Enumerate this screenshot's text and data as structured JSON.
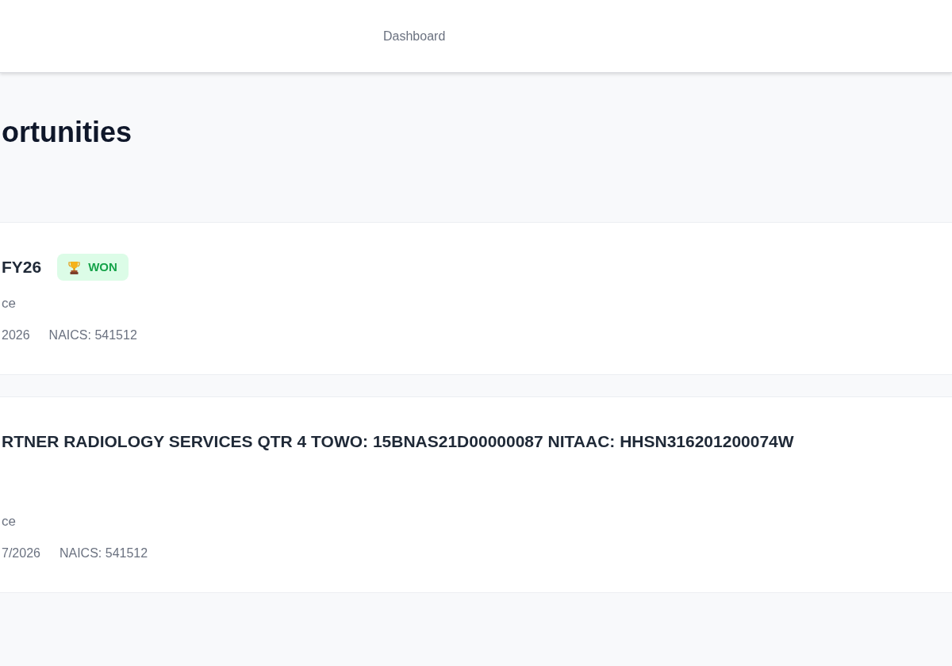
{
  "header": {
    "nav_links": [
      {
        "label": "Dashboard"
      }
    ]
  },
  "page_title": "ortunities",
  "opportunities": [
    {
      "title": "FY26",
      "status": {
        "kind": "won",
        "label": "WON"
      },
      "line_2": "ce",
      "meta": [
        "2026",
        "NAICS: 541512"
      ]
    },
    {
      "title": "RTNER RADIOLOGY SERVICES QTR 4 TOWO: 15BNAS21D00000087 NITAAC: HHSN316201200074W",
      "line_2": "ce",
      "meta": [
        "7/2026",
        "NAICS: 541512"
      ]
    }
  ]
}
